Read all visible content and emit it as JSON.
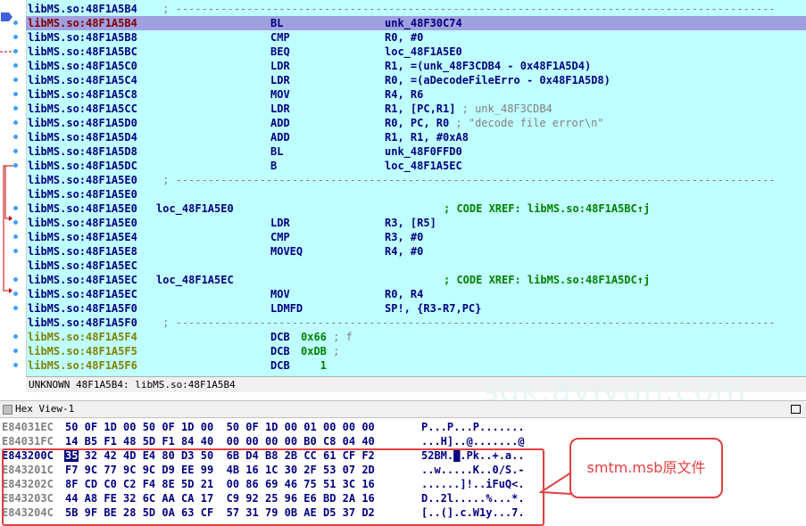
{
  "disasm": [
    {
      "addr": "libMS.so:48F1A5B4",
      "kind": "sep",
      "text": " ; ---------------------------------------------------------------------------------------------"
    },
    {
      "addr": "libMS.so:48F1A5B4",
      "kind": "code",
      "highlight": true,
      "mnem": "BL",
      "ops": "unk_48F30C74"
    },
    {
      "addr": "libMS.so:48F1A5B8",
      "kind": "code",
      "mnem": "CMP",
      "ops": "R0, #0"
    },
    {
      "addr": "libMS.so:48F1A5BC",
      "kind": "code",
      "mnem": "BEQ",
      "ops": "loc_48F1A5E0"
    },
    {
      "addr": "libMS.so:48F1A5C0",
      "kind": "code",
      "mnem": "LDR",
      "ops": "R1, =(unk_48F3CDB4 - 0x48F1A5D4)"
    },
    {
      "addr": "libMS.so:48F1A5C4",
      "kind": "code",
      "mnem": "LDR",
      "ops": "R0, =(aDecodeFileErro - 0x48F1A5D8)"
    },
    {
      "addr": "libMS.so:48F1A5C8",
      "kind": "code",
      "mnem": "MOV",
      "ops": "R4, R6"
    },
    {
      "addr": "libMS.so:48F1A5CC",
      "kind": "code",
      "mnem": "LDR",
      "ops": "R1, [PC,R1]",
      "comment": " ; unk_48F3CDB4"
    },
    {
      "addr": "libMS.so:48F1A5D0",
      "kind": "code",
      "mnem": "ADD",
      "ops": "R0, PC, R0",
      "comment": " ; \"decode file error\\n\""
    },
    {
      "addr": "libMS.so:48F1A5D4",
      "kind": "code",
      "mnem": "ADD",
      "ops": "R1, R1, #0xA8"
    },
    {
      "addr": "libMS.so:48F1A5D8",
      "kind": "code",
      "mnem": "BL",
      "ops": "unk_48F0FFD0"
    },
    {
      "addr": "libMS.so:48F1A5DC",
      "kind": "code",
      "mnem": "B",
      "ops": "loc_48F1A5EC"
    },
    {
      "addr": "libMS.so:48F1A5E0",
      "kind": "sep",
      "text": " ; ---------------------------------------------------------------------------------------------"
    },
    {
      "addr": "libMS.so:48F1A5E0",
      "kind": "code"
    },
    {
      "addr": "libMS.so:48F1A5E0",
      "kind": "label",
      "label": "loc_48F1A5E0",
      "xref": "; CODE XREF: libMS.so:48F1A5BC↑j"
    },
    {
      "addr": "libMS.so:48F1A5E0",
      "kind": "code",
      "mnem": "LDR",
      "ops": "R3, [R5]"
    },
    {
      "addr": "libMS.so:48F1A5E4",
      "kind": "code",
      "mnem": "CMP",
      "ops": "R3, #0"
    },
    {
      "addr": "libMS.so:48F1A5E8",
      "kind": "code",
      "mnem": "MOVEQ",
      "ops": "R4, #0"
    },
    {
      "addr": "libMS.so:48F1A5EC",
      "kind": "code"
    },
    {
      "addr": "libMS.so:48F1A5EC",
      "kind": "label",
      "label": "loc_48F1A5EC",
      "xref": "; CODE XREF: libMS.so:48F1A5DC↑j"
    },
    {
      "addr": "libMS.so:48F1A5EC",
      "kind": "code",
      "mnem": "MOV",
      "ops": "R0, R4"
    },
    {
      "addr": "libMS.so:48F1A5F0",
      "kind": "code",
      "mnem": "LDMFD",
      "ops": "SP!, {R3-R7,PC}"
    },
    {
      "addr": "libMS.so:48F1A5F0",
      "kind": "sep",
      "text": " ; ---------------------------------------------------------------------------------------------"
    },
    {
      "addr": "libMS.so:48F1A5F4",
      "kind": "data",
      "mnem": "DCB",
      "ops": "0x66",
      "comment": " ; f"
    },
    {
      "addr": "libMS.so:48F1A5F5",
      "kind": "data",
      "mnem": "DCB",
      "ops": "0xDB",
      "comment": " ;"
    },
    {
      "addr": "libMS.so:48F1A5F6",
      "kind": "data",
      "mnem": "DCB",
      "ops": "   1"
    }
  ],
  "status_text": "UNKNOWN 48F1A5B4: libMS.so:48F1A5B4",
  "hex_view_title": "Hex View-1",
  "hex_rows": [
    {
      "addr": "E84031EC",
      "bytes": "50 0F 1D 00 50 0F 1D 00  50 0F 1D 00 01 00 00 00",
      "ascii": "P...P...P......."
    },
    {
      "addr": "E84031FC",
      "bytes": "14 B5 F1 48 5D F1 84 40  00 00 00 00 B0 C8 04 40",
      "ascii": "...H]..@.......@"
    },
    {
      "addr": "E843200C",
      "bytes": "35 32 42 4D E4 80 D3 50  6B D4 B8 2B CC 61 CF F2",
      "ascii": "52BM.█.Pk..+.a.."
    },
    {
      "addr": "E843201C",
      "bytes": "F7 9C 77 9C 9C D9 EE 99  4B 16 1C 30 2F 53 07 2D",
      "ascii": "..w.....K..0/S.-"
    },
    {
      "addr": "E843202C",
      "bytes": "8F CD C0 C2 F4 8E 5D 21  00 86 69 46 75 51 3C 16",
      "ascii": "......]!..iFuQ<."
    },
    {
      "addr": "E843203C",
      "bytes": "44 A8 FE 32 6C AA CA 17  C9 92 25 96 E6 BD 2A 16",
      "ascii": "D..2l.....%...*."
    },
    {
      "addr": "E843204C",
      "bytes": "5B 9F BE 28 5D 0A 63 CF  57 31 79 0B AE D5 37 D2",
      "ascii": "[..(].c.W1y...7."
    }
  ],
  "callout_text": "smtm.msb原文件",
  "watermark_text": "sdk.aviyun.com"
}
